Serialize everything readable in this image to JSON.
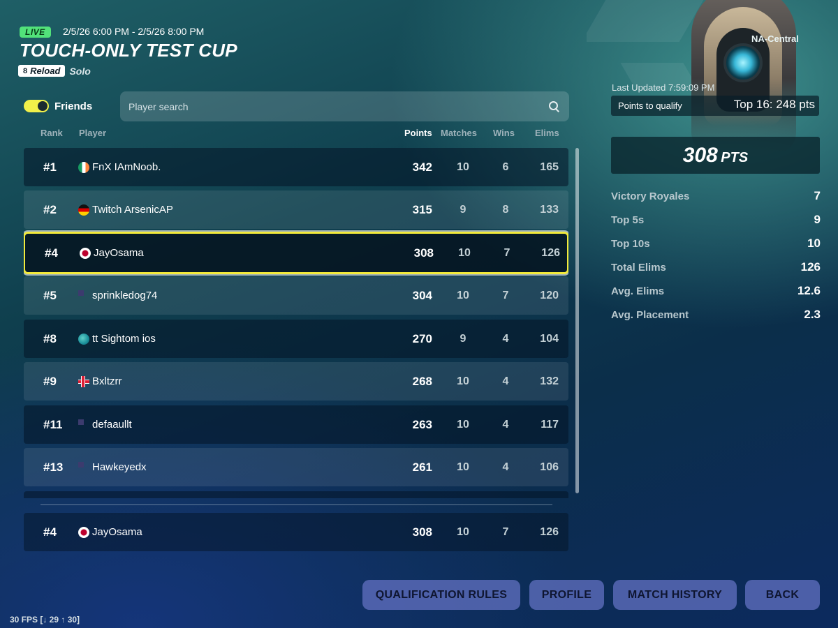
{
  "header": {
    "live_label": "LIVE",
    "date_range": "2/5/26 6:00 PM - 2/5/26 8:00 PM",
    "title": "TOUCH-ONLY TEST CUP",
    "mode_badge": "Reload",
    "mode": "Solo",
    "region": "NA-Central"
  },
  "filters": {
    "friends_label": "Friends",
    "friends_on": true,
    "search_placeholder": "Player search",
    "search_value": ""
  },
  "columns": {
    "rank": "Rank",
    "player": "Player",
    "points": "Points",
    "matches": "Matches",
    "wins": "Wins",
    "elims": "Elims"
  },
  "leaderboard": [
    {
      "rank": "#1",
      "flag": "ireland-flag",
      "player": "FnX IAmNoob.",
      "points": "342",
      "matches": "10",
      "wins": "6",
      "elims": "165"
    },
    {
      "rank": "#2",
      "flag": "germany-flag",
      "player": "Twitch ArsenicAP",
      "points": "315",
      "matches": "9",
      "wins": "8",
      "elims": "133"
    },
    {
      "rank": "#4",
      "flag": "japan-flag",
      "player": "JayOsama",
      "points": "308",
      "matches": "10",
      "wins": "7",
      "elims": "126",
      "highlighted": true
    },
    {
      "rank": "#5",
      "flag": "usa-flag",
      "player": "sprinkledog74",
      "points": "304",
      "matches": "10",
      "wins": "7",
      "elims": "120"
    },
    {
      "rank": "#8",
      "flag": "globe-flag",
      "player": "tt Sightom ios",
      "points": "270",
      "matches": "9",
      "wins": "4",
      "elims": "104"
    },
    {
      "rank": "#9",
      "flag": "iceland-flag",
      "player": "Bxltzrr",
      "points": "268",
      "matches": "10",
      "wins": "4",
      "elims": "132"
    },
    {
      "rank": "#11",
      "flag": "usa-flag",
      "player": "defaaullt",
      "points": "263",
      "matches": "10",
      "wins": "4",
      "elims": "117"
    },
    {
      "rank": "#13",
      "flag": "usa-flag",
      "player": "Hawkeyedx",
      "points": "261",
      "matches": "10",
      "wins": "4",
      "elims": "106"
    }
  ],
  "self_row": {
    "rank": "#4",
    "flag": "japan-flag",
    "player": "JayOsama",
    "points": "308",
    "matches": "10",
    "wins": "7",
    "elims": "126"
  },
  "summary": {
    "last_updated": "Last Updated 7:59:09 PM",
    "qualify_label": "Points to qualify",
    "qualify_value": "Top 16: 248 pts",
    "points": "308",
    "points_unit": "PTS",
    "stats": [
      {
        "label": "Victory Royales",
        "value": "7"
      },
      {
        "label": "Top 5s",
        "value": "9"
      },
      {
        "label": "Top 10s",
        "value": "10"
      },
      {
        "label": "Total Elims",
        "value": "126"
      },
      {
        "label": "Avg. Elims",
        "value": "12.6"
      },
      {
        "label": "Avg. Placement",
        "value": "2.3"
      }
    ]
  },
  "buttons": {
    "rules": "QUALIFICATION RULES",
    "profile": "PROFILE",
    "history": "MATCH HISTORY",
    "back": "BACK"
  },
  "fps_text": "30 FPS [↓ 29 ↑ 30]",
  "colors": {
    "live": "#52e27a",
    "highlight_border": "#f2ea3b",
    "toggle": "#f1f04a",
    "button_bg": "#5f6ebe"
  }
}
